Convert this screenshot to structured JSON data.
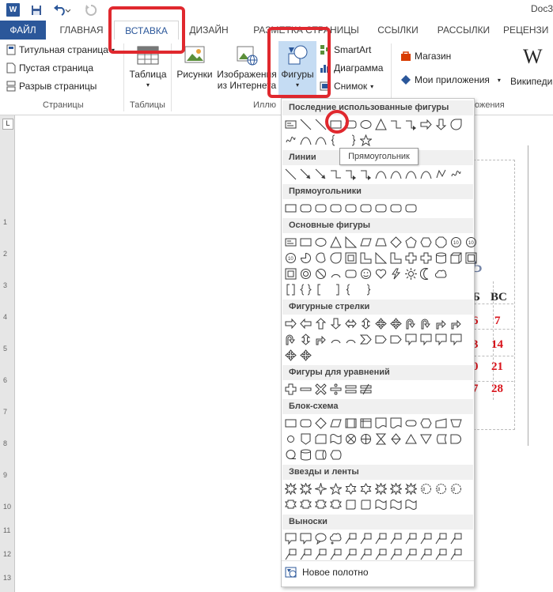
{
  "titlebar": {
    "doc_title": "Doc3"
  },
  "tabs": [
    {
      "label": "ФАЙЛ"
    },
    {
      "label": "ГЛАВНАЯ"
    },
    {
      "label": "ВСТАВКА"
    },
    {
      "label": "ДИЗАЙН"
    },
    {
      "label": "РАЗМЕТКА СТРАНИЦЫ"
    },
    {
      "label": "ССЫЛКИ"
    },
    {
      "label": "РАССЫЛКИ"
    },
    {
      "label": "РЕЦЕНЗИ"
    }
  ],
  "ribbon": {
    "pages": {
      "cover": "Титульная страница",
      "blank": "Пустая страница",
      "break": "Разрыв страницы",
      "group": "Страницы"
    },
    "tables": {
      "table": "Таблица",
      "group": "Таблицы"
    },
    "illustrations": {
      "pictures": "Рисунки",
      "online1": "Изображения",
      "online2": "из Интернета",
      "shapes": "Фигуры",
      "smartart": "SmartArt",
      "chart": "Диаграмма",
      "screenshot": "Снимок",
      "group": "Иллю"
    },
    "apps": {
      "store": "Магазин",
      "myapps": "Мои приложения",
      "group": "ожения",
      "wiki": "Википеди"
    }
  },
  "menu": {
    "sections": [
      {
        "title": "Последние использованные фигуры"
      },
      {
        "title": "Линии"
      },
      {
        "title": "Прямоугольники"
      },
      {
        "title": "Основные фигуры"
      },
      {
        "title": "Фигурные стрелки"
      },
      {
        "title": "Фигуры для уравнений"
      },
      {
        "title": "Блок-схема"
      },
      {
        "title": "Звезды и ленты"
      },
      {
        "title": "Выноски"
      }
    ],
    "tooltip": "Прямоугольник",
    "new_canvas": "Новое полотно"
  },
  "calendar": {
    "header_sat": "Б",
    "header_sun": "ВС",
    "cells": [
      "6",
      "7",
      "3",
      "14",
      "0",
      "21",
      "7",
      "28"
    ],
    "decor": "рь"
  },
  "ruler": [
    "1",
    "2",
    "3",
    "4",
    "5",
    "6",
    "7",
    "8",
    "9",
    "10",
    "11",
    "12",
    "13"
  ],
  "colors": {
    "accent": "#2b579a",
    "highlight": "#e0282e",
    "red_text": "#d9141c"
  }
}
